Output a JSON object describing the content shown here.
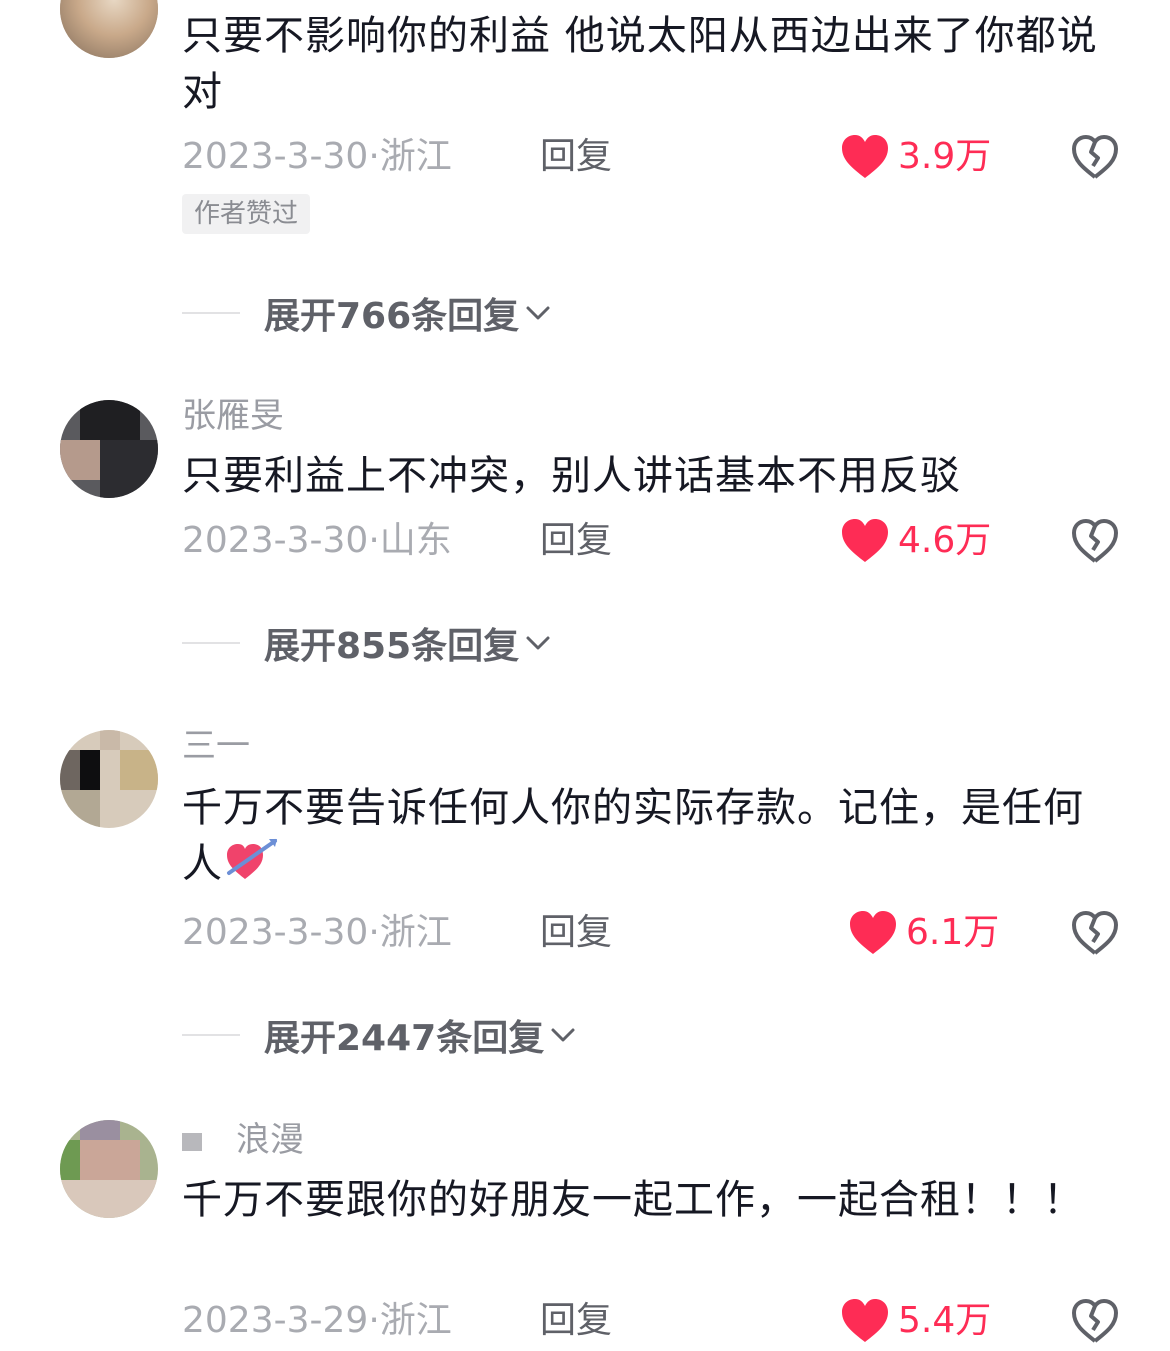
{
  "comments": [
    {
      "username": "",
      "text": "只要不影响你的利益 他说太阳从西边出来了你都说对",
      "date": "2023-3-30",
      "location": "浙江",
      "reply_label": "回复",
      "likes": "3.9万",
      "badge": "作者赞过",
      "expand_label": "展开766条回复"
    },
    {
      "username": "张雁旻",
      "text": "只要利益上不冲突，别人讲话基本不用反驳",
      "date": "2023-3-30",
      "location": "山东",
      "reply_label": "回复",
      "likes": "4.6万",
      "expand_label": "展开855条回复"
    },
    {
      "username": "三一",
      "text": "千万不要告诉任何人你的实际存款。记住，是任何人",
      "date": "2023-3-30",
      "location": "浙江",
      "reply_label": "回复",
      "likes": "6.1万",
      "expand_label": "展开2447条回复"
    },
    {
      "username": "浪漫",
      "text": "千万不要跟你的好朋友一起工作，一起合租！！！",
      "date": "2023-3-29",
      "location": "浙江",
      "reply_label": "回复",
      "likes": "5.4万"
    }
  ],
  "icons": {
    "like": "heart-icon",
    "dislike": "broken-heart-icon",
    "expand": "chevron-down-icon",
    "emoji": "heart-with-arrow-emoji"
  },
  "colors": {
    "like_red": "#fe2c55",
    "meta_gray": "#a9abb1",
    "text_dark": "#161823"
  }
}
